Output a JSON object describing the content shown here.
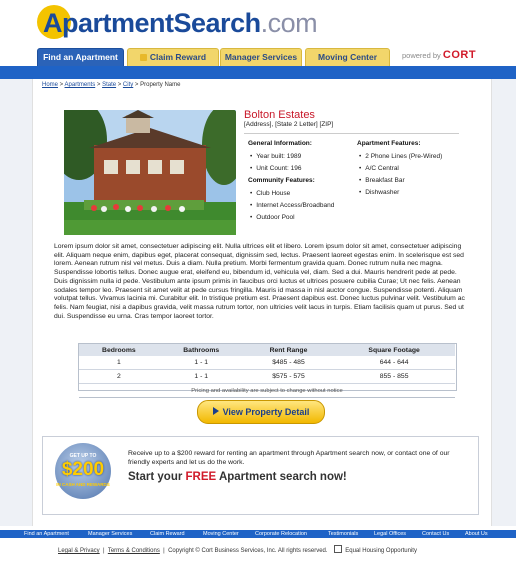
{
  "header": {
    "logo_a": "A",
    "logo_rest": "partment",
    "logo_search": "Search",
    "logo_tld": ".com",
    "powered_by": "powered by",
    "powered_brand": "CORT"
  },
  "tabs": [
    {
      "label": "Find an Apartment"
    },
    {
      "label": "Claim Reward"
    },
    {
      "label": "Manager Services"
    },
    {
      "label": "Moving Center"
    }
  ],
  "breadcrumb": {
    "home": "Home",
    "apartments": "Apartments",
    "state": "State",
    "city": "City",
    "sep": " > ",
    "current": "Property Name"
  },
  "property": {
    "name": "Bolton Estates",
    "address": "[Address], [State 2 Letter] [ZIP]"
  },
  "general_info": {
    "heading": "General Information:",
    "items": [
      "Year built: 1989",
      "Unit Count: 196"
    ]
  },
  "community_features": {
    "heading": "Community Features:",
    "items": [
      "Club House",
      "Internet Access/Broadband",
      "Outdoor Pool"
    ]
  },
  "apartment_features": {
    "heading": "Apartment Features:",
    "items": [
      "2 Phone Lines (Pre-Wired)",
      "A/C Central",
      "Breakfast Bar",
      "Dishwasher"
    ]
  },
  "description": "Lorem ipsum dolor sit amet, consectetuer adipiscing elit. Nulla ultrices elit et libero. Lorem ipsum dolor sit amet, consectetuer adipiscing elit. Aliquam neque enim, dapibus eget, placerat consequat, dignissim sed, lectus. Praesent laoreet egestas enim. In scelerisque est sed lorem. Aenean rutrum nisl vel metus. Duis a diam. Nulla pretium. Morbi fermentum gravida quam. Donec rutrum nulla nec magna. Suspendisse lobortis tellus. Donec augue erat, eleifend eu, bibendum id, vehicula vel, diam. Sed a dui. Mauris hendrerit pede at pede. Duis dignissim nulla id pede. Vestibulum ante ipsum primis in faucibus orci luctus et ultrices posuere cubilia Curae; Ut nec felis. Aenean sodales tempor leo. Praesent sit amet velit at pede cursus fringilla. Mauris id massa in nisl auctor congue. Suspendisse potenti. Aliquam volutpat tellus. Vivamus lacinia mi. Curabitur elit. In tristique pretium est. Praesent dapibus est. Donec luctus pulvinar velit. Vestibulum ac felis. Nam feugiat, nisi a dapibus gravida, velit massa rutrum tortor, non ultricies velit lacus in turpis. Etiam facilisis quam ut purus. Sed ut dui. Suspendisse eu urna. Cras tempor laoreet tortor.",
  "units": {
    "headers": [
      "Bedrooms",
      "Bathrooms",
      "Rent Range",
      "Square Footage"
    ],
    "rows": [
      [
        "1",
        "1 - 1",
        "$485 - 485",
        "644 - 644"
      ],
      [
        "2",
        "1 - 1",
        "$575 - 575",
        "855 - 855"
      ]
    ],
    "note": "Pricing and availability are subject to change without notice"
  },
  "view_button": "View Property Detail",
  "promo": {
    "badge_top": "GET UP TO",
    "badge_amount": "$200",
    "badge_bottom": "IN CASH AND REWARDS",
    "text": "Receive up to a $200 reward for renting an apartment through Apartment search now, or contact one of our friendly experts and let us do the work.",
    "cta_start": "Start your ",
    "cta_free": "FREE",
    "cta_end": " Apartment search now!"
  },
  "footer_links": [
    "Find an Apartment",
    "Manager Services",
    "Claim Reward",
    "Moving Center",
    "Corporate Relocation",
    "Testimonials",
    "Legal Offices",
    "Contact Us",
    "About Us"
  ],
  "legal": {
    "privacy": "Legal & Privacy",
    "terms": "Terms & Conditions",
    "copyright": "Copyright © Cort Business Services, Inc. All rights reserved.",
    "eho": "Equal Housing Opportunity"
  },
  "colors": {
    "brand_blue": "#1f63c6",
    "tab_yellow": "#f2d66b",
    "accent_red": "#c8192a",
    "logo_yellow": "#f3c300"
  }
}
